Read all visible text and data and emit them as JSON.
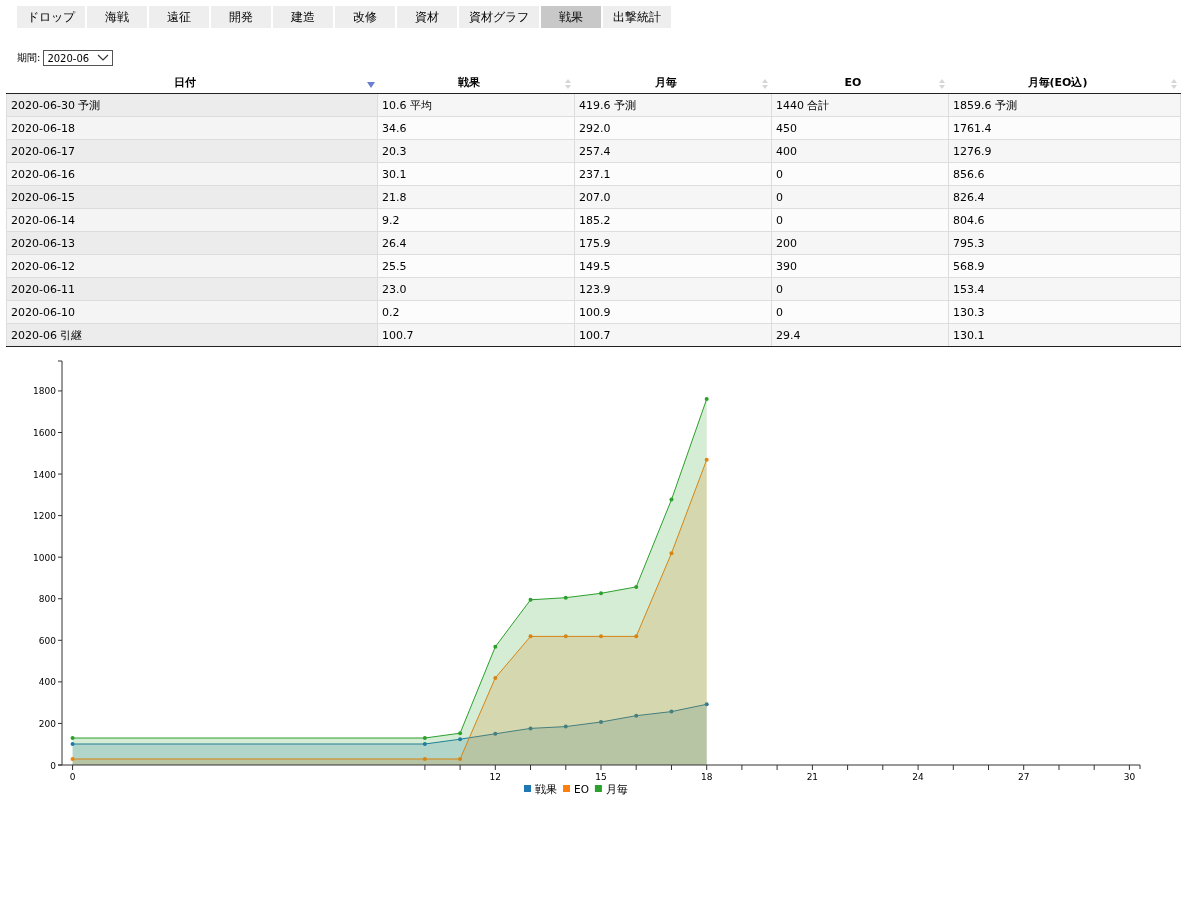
{
  "tabs": [
    {
      "label": "ドロップ",
      "selected": false
    },
    {
      "label": "海戦",
      "selected": false
    },
    {
      "label": "遠征",
      "selected": false
    },
    {
      "label": "開発",
      "selected": false
    },
    {
      "label": "建造",
      "selected": false
    },
    {
      "label": "改修",
      "selected": false
    },
    {
      "label": "資材",
      "selected": false
    },
    {
      "label": "資材グラフ",
      "selected": false
    },
    {
      "label": "戦果",
      "selected": true
    },
    {
      "label": "出撃統計",
      "selected": false
    }
  ],
  "period": {
    "label": "期間:",
    "value": "2020-06"
  },
  "table": {
    "columns": [
      {
        "label": "日付",
        "sorted": true
      },
      {
        "label": "戦果",
        "sorted": false
      },
      {
        "label": "月毎",
        "sorted": false
      },
      {
        "label": "EO",
        "sorted": false
      },
      {
        "label": "月毎(EO込)",
        "sorted": false
      }
    ],
    "rows": [
      [
        "2020-06-30 予測",
        "10.6 平均",
        "419.6 予測",
        "1440 合計",
        "1859.6 予測"
      ],
      [
        "2020-06-18",
        "34.6",
        "292.0",
        "450",
        "1761.4"
      ],
      [
        "2020-06-17",
        "20.3",
        "257.4",
        "400",
        "1276.9"
      ],
      [
        "2020-06-16",
        "30.1",
        "237.1",
        "0",
        "856.6"
      ],
      [
        "2020-06-15",
        "21.8",
        "207.0",
        "0",
        "826.4"
      ],
      [
        "2020-06-14",
        "9.2",
        "185.2",
        "0",
        "804.6"
      ],
      [
        "2020-06-13",
        "26.4",
        "175.9",
        "200",
        "795.3"
      ],
      [
        "2020-06-12",
        "25.5",
        "149.5",
        "390",
        "568.9"
      ],
      [
        "2020-06-11",
        "23.0",
        "123.9",
        "0",
        "153.4"
      ],
      [
        "2020-06-10",
        "0.2",
        "100.9",
        "0",
        "130.3"
      ],
      [
        "2020-06 引継",
        "100.7",
        "100.7",
        "29.4",
        "130.1"
      ]
    ]
  },
  "chart": {
    "chart_data": {
      "type": "area",
      "x": [
        0,
        10,
        11,
        12,
        13,
        14,
        15,
        16,
        17,
        18
      ],
      "series": [
        {
          "name": "戦果",
          "color": "#1f77b4",
          "values": [
            101,
            101,
            124,
            150,
            176,
            185,
            207,
            237,
            257,
            292
          ]
        },
        {
          "name": "EO",
          "color": "#ff7f0e",
          "values": [
            29,
            29,
            29,
            419,
            619,
            619,
            619,
            619,
            1019,
            1469
          ]
        },
        {
          "name": "月毎",
          "color": "#2ca02c",
          "values": [
            130,
            130,
            153,
            569,
            795,
            805,
            826,
            857,
            1277,
            1761
          ]
        }
      ],
      "xlim": [
        -0.3,
        30.3
      ],
      "ylim": [
        0,
        1944
      ],
      "legend": "bottom",
      "xticks": [
        0,
        12,
        15,
        18,
        21,
        24,
        27,
        30
      ],
      "yticks": [
        0,
        200,
        400,
        600,
        800,
        1000,
        1200,
        1400,
        1600,
        1800
      ],
      "stacked": false
    }
  }
}
